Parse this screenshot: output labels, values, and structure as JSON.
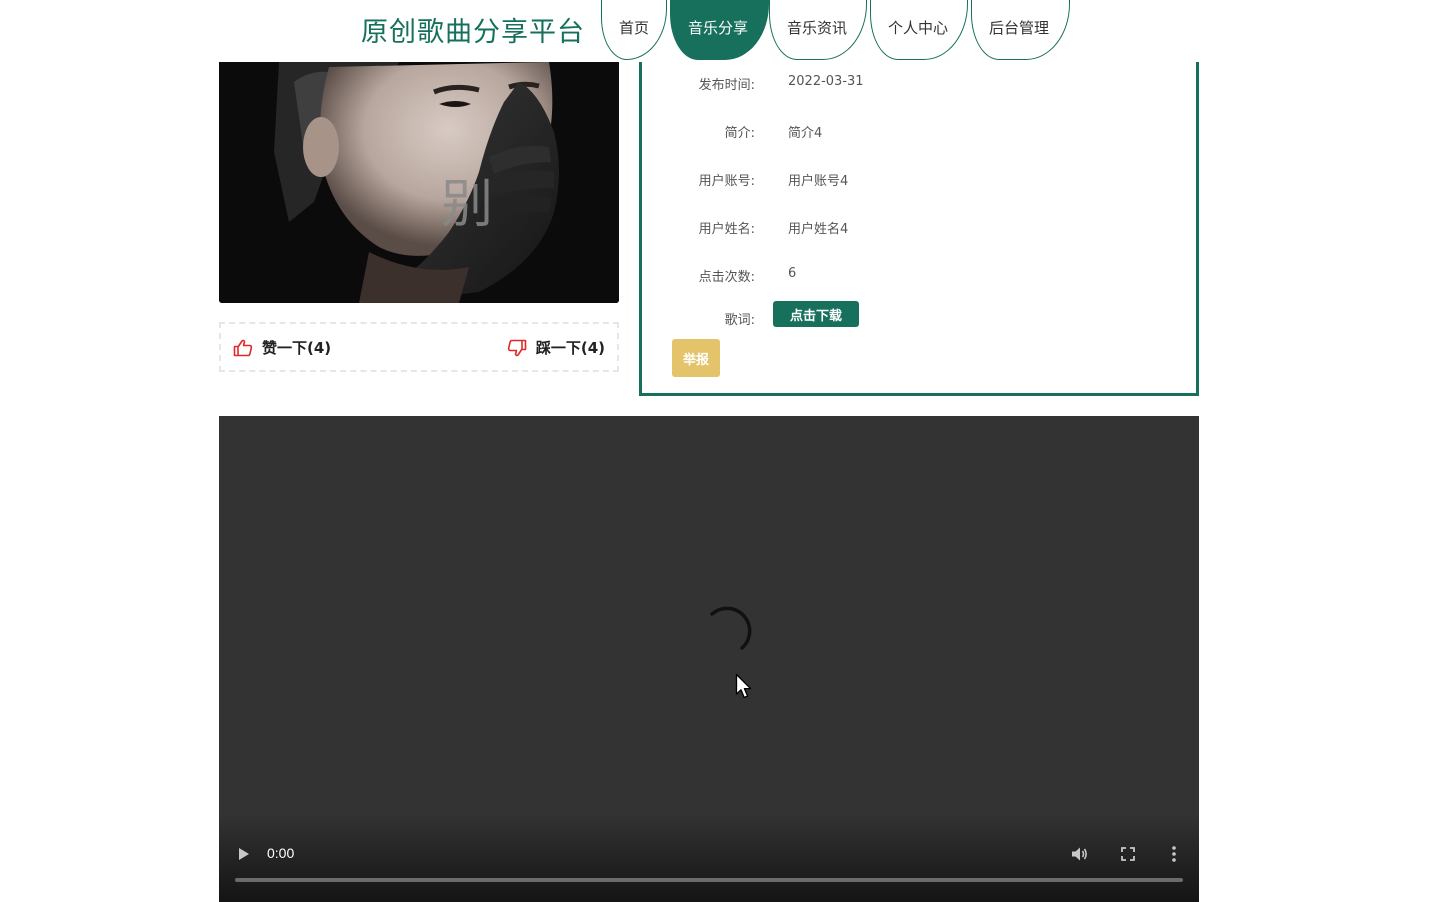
{
  "header": {
    "site_title": "原创歌曲分享平台",
    "nav": [
      {
        "label": "首页",
        "active": false
      },
      {
        "label": "音乐分享",
        "active": true
      },
      {
        "label": "音乐资讯",
        "active": false
      },
      {
        "label": "个人中心",
        "active": false
      },
      {
        "label": "后台管理",
        "active": false
      }
    ]
  },
  "cover": {
    "overlay_text": "别",
    "icon": "album-cover-image"
  },
  "votes": {
    "up_label": "赞一下(4)",
    "down_label": "踩一下(4)",
    "up_icon": "thumbs-up-icon",
    "down_icon": "thumbs-down-icon",
    "icon_color": "#e02a2a"
  },
  "info": {
    "rows": [
      {
        "label": "发布时间:",
        "value": "2022-03-31"
      },
      {
        "label": "简介:",
        "value": "简介4"
      },
      {
        "label": "用户账号:",
        "value": "用户账号4"
      },
      {
        "label": "用户姓名:",
        "value": "用户姓名4"
      },
      {
        "label": "点击次数:",
        "value": "6"
      }
    ],
    "lyrics_label": "歌词:",
    "download_label": "点击下载",
    "report_label": "举报"
  },
  "player": {
    "time": "0:00",
    "state": "loading",
    "progress": 0
  },
  "colors": {
    "primary": "#17705c",
    "report": "#e3c46b",
    "player_bg": "#333333"
  }
}
